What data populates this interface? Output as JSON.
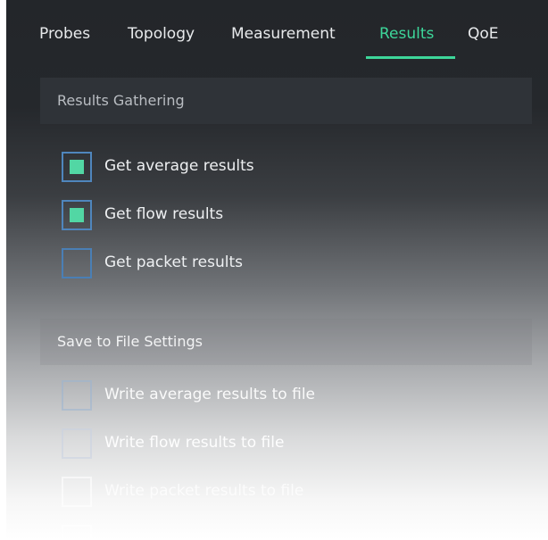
{
  "tabs": [
    {
      "label": "Probes",
      "active": false
    },
    {
      "label": "Topology",
      "active": false
    },
    {
      "label": "Measurement",
      "active": false
    },
    {
      "label": "Results",
      "active": true
    },
    {
      "label": "QoE",
      "active": false
    }
  ],
  "results_gathering": {
    "title": "Results Gathering",
    "options": [
      {
        "label": "Get average results",
        "checked": true
      },
      {
        "label": "Get flow results",
        "checked": true
      },
      {
        "label": "Get packet results",
        "checked": false
      }
    ]
  },
  "save_settings": {
    "title": "Save to File Settings",
    "options": [
      {
        "label": "Write average results to file",
        "checked": false
      },
      {
        "label": "Write flow results to file",
        "checked": false
      },
      {
        "label": "Write packet results to file",
        "checked": false
      },
      {
        "label": "",
        "checked": false
      }
    ]
  },
  "colors": {
    "accent": "#3dd69a",
    "checkbox_border": "#4f86bd",
    "checkbox_fill": "#52d7a4",
    "background": "#23262a"
  }
}
